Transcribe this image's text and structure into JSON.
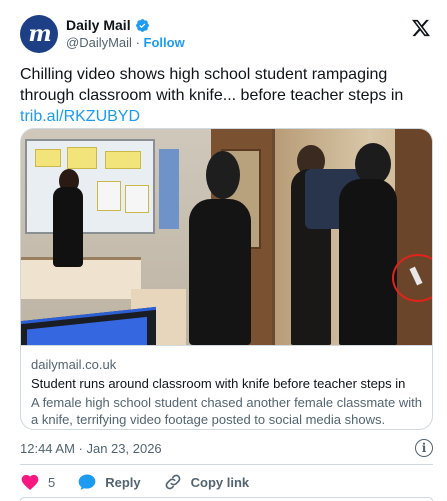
{
  "account": {
    "name": "Daily Mail",
    "handle": "@DailyMail",
    "separator": "·",
    "follow_label": "Follow",
    "avatar_letter": "m",
    "brand_color": "#1d3f85",
    "verified_color": "#1d9bf0"
  },
  "tweet": {
    "text": "Chilling video shows high school student rampaging through classroom with knife... before teacher steps in",
    "link": "trib.al/RKZUBYD",
    "timestamp": "12:44 AM · Jan 23, 2026"
  },
  "card": {
    "domain": "dailymail.co.uk",
    "title": "Student runs around classroom with knife before teacher steps in",
    "description": "A female high school student chased another female classmate with a knife, terrifying video footage posted to social media shows."
  },
  "actions": {
    "like_count": "5",
    "reply_label": "Reply",
    "copy_label": "Copy link",
    "like_color": "#f91880",
    "reply_color": "#1d9bf0"
  },
  "icons": {
    "close": "x-logo-icon",
    "info": "info-icon",
    "like": "heart-icon",
    "reply": "reply-bubble-icon",
    "copy": "link-icon"
  }
}
